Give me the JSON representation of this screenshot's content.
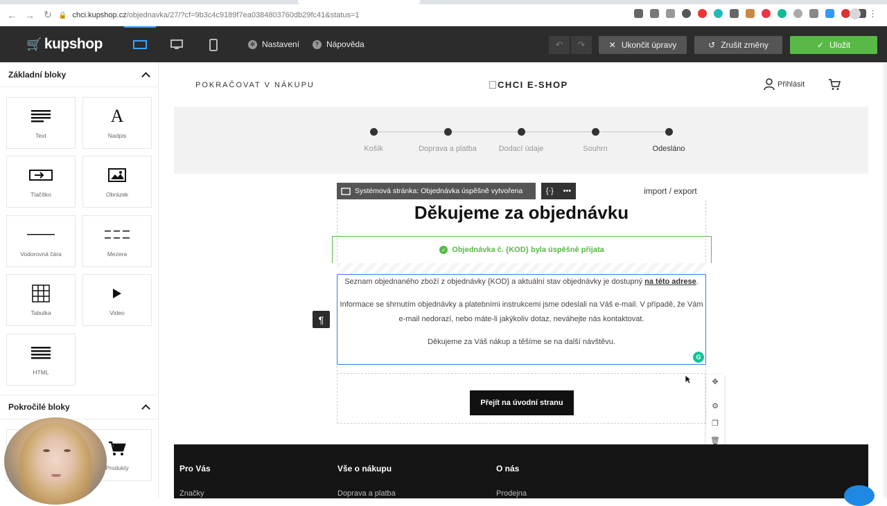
{
  "browser": {
    "url_host": "chci.kupshop.cz",
    "url_path": "/objednavka/27/?cf=9b3c4c9189f7ea0384803760db29fc41&status=1"
  },
  "toolbar": {
    "logo": "kupshop",
    "settings_label": "Nastavení",
    "help_label": "Nápověda",
    "end_edit_label": "Ukončit úpravy",
    "discard_label": "Zrušit změny",
    "save_label": "Uložit"
  },
  "panel": {
    "basic_title": "Základní bloky",
    "advanced_title": "Pokročilé bloky",
    "blocks": [
      {
        "label": "Text",
        "icon": "text-lines-icon"
      },
      {
        "label": "Nadpis",
        "icon": "heading-icon"
      },
      {
        "label": "Tlačítko",
        "icon": "button-icon"
      },
      {
        "label": "Obrázek",
        "icon": "image-icon"
      },
      {
        "label": "Vodorovná čára",
        "icon": "horizontal-line-icon"
      },
      {
        "label": "Mezera",
        "icon": "spacer-icon"
      },
      {
        "label": "Tabulka",
        "icon": "table-icon"
      },
      {
        "label": "Video",
        "icon": "play-icon"
      },
      {
        "label": "HTML",
        "icon": "html-icon"
      }
    ],
    "advanced_blocks": [
      {
        "label": "Produkty",
        "icon": "cart-icon"
      }
    ]
  },
  "shop": {
    "continue": "POKRAČOVAT V NÁKUPU",
    "logo_alt": "CHCI E-SHOP",
    "login": "Přihlásit",
    "steps": [
      "Košík",
      "Doprava a platba",
      "Dodací údaje",
      "Souhrn",
      "Odesláno"
    ]
  },
  "content": {
    "system_label": "Systémová stránka: Objednávka úspěšně vytvořena",
    "import_export": "import / export",
    "title": "Děkujeme za objednávku",
    "success": "Objednávka č. {KOD} byla úspěšně přijata",
    "para1_a": "Seznam objednaného zboží z objednávky {KOD} a aktuální stav objednávky je dostupný ",
    "para1_link": "na této adrese",
    "para1_end": ".",
    "para2": "Informace se shrnutím objednávky a platebními instrukcemi jsme odeslali na Váš e-mail. V případě, že Vám e-mail nedorazí, nebo máte-li jakýkoliv dotaz, neváhejte nás kontaktovat.",
    "para3": "Děkujeme za Váš nákup a těšíme se na další návštěvu.",
    "home_button": "Přejít na úvodní stranu"
  },
  "footer": {
    "col1_title": "Pro Vás",
    "col2_title": "Vše o nákupu",
    "col3_title": "O nás",
    "col1_link": "Značky",
    "col2_link": "Doprava a platba",
    "col3_link": "Prodejna"
  },
  "colors": {
    "accent_blue": "#3aa3ff",
    "success_green": "#58b947",
    "dark_bar": "#2c2c2c"
  }
}
